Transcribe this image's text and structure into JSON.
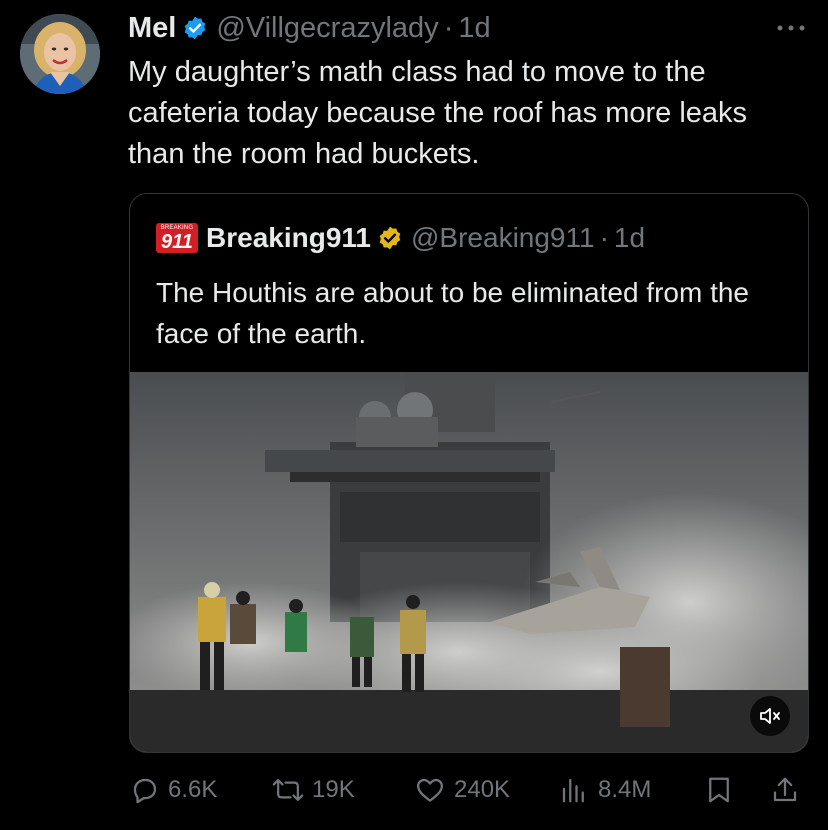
{
  "tweet": {
    "author_name": "Mel",
    "handle": "@Villgecrazylady",
    "separator": "·",
    "time": "1d",
    "text": "My daughter’s math class had to move to the cafeteria today because the roof has more leaks than the room had buckets."
  },
  "quoted": {
    "logo_small": "BREAKING",
    "logo_big": "911",
    "author_name": "Breaking911",
    "handle": "@Breaking911",
    "separator": "·",
    "time": "1d",
    "text": "The Houthis are about to be eliminated from the face of the earth."
  },
  "actions": {
    "replies": "6.6K",
    "reposts": "19K",
    "likes": "240K",
    "views": "8.4M"
  },
  "colors": {
    "background": "#000000",
    "text": "#e7e9ea",
    "muted": "#71767b",
    "verified_blue": "#1d9bf0",
    "verified_gold": "#e2b719",
    "breaking_red": "#d21f26"
  },
  "icons": [
    "more-icon",
    "verified-blue-icon",
    "verified-gold-icon",
    "mute-icon",
    "reply-icon",
    "repost-icon",
    "like-icon",
    "views-icon",
    "bookmark-icon",
    "share-icon"
  ]
}
